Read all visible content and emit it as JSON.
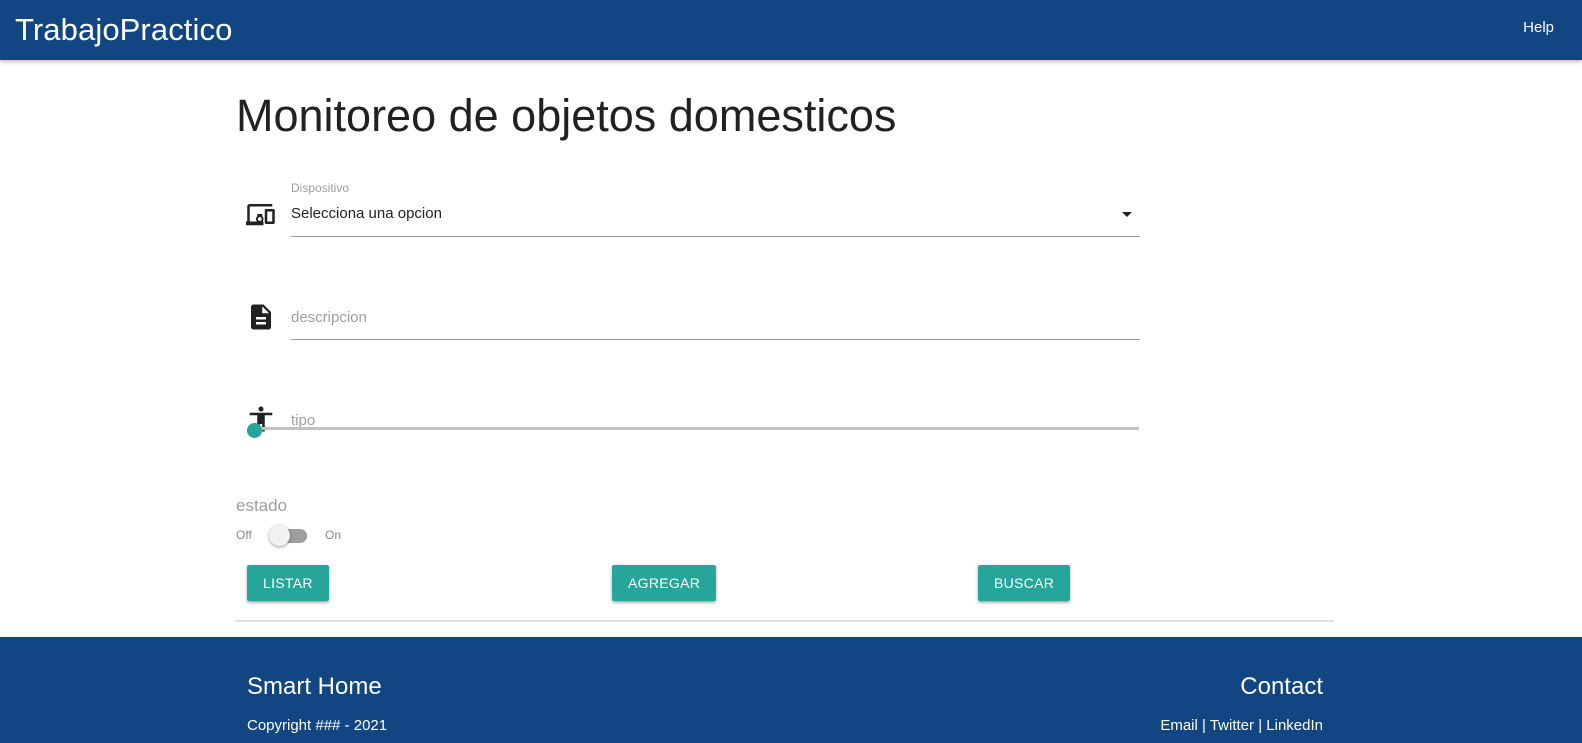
{
  "navbar": {
    "brand": "TrabajoPractico",
    "help": "Help"
  },
  "main": {
    "title": "Monitoreo de objetos domesticos",
    "dispositivo": {
      "label": "Dispositivo",
      "selected": "Selecciona una opcion",
      "icon": "devices-icon"
    },
    "descripcion": {
      "placeholder": "descripcion",
      "icon": "description-icon"
    },
    "tipo": {
      "placeholder": "tipo",
      "icon": "accessibility-icon",
      "value": 0
    },
    "estado": {
      "label": "estado",
      "off": "Off",
      "on": "On",
      "checked": false
    },
    "buttons": {
      "listar": "Listar",
      "agregar": "Agregar",
      "buscar": "Buscar"
    }
  },
  "footer": {
    "left_title": "Smart Home",
    "copyright": "Copyright ### - 2021",
    "right_title": "Contact",
    "links": [
      "Email",
      "Twitter",
      "LinkedIn"
    ],
    "separator": "|"
  },
  "colors": {
    "primary": "#124682",
    "accent": "#26a69a"
  }
}
